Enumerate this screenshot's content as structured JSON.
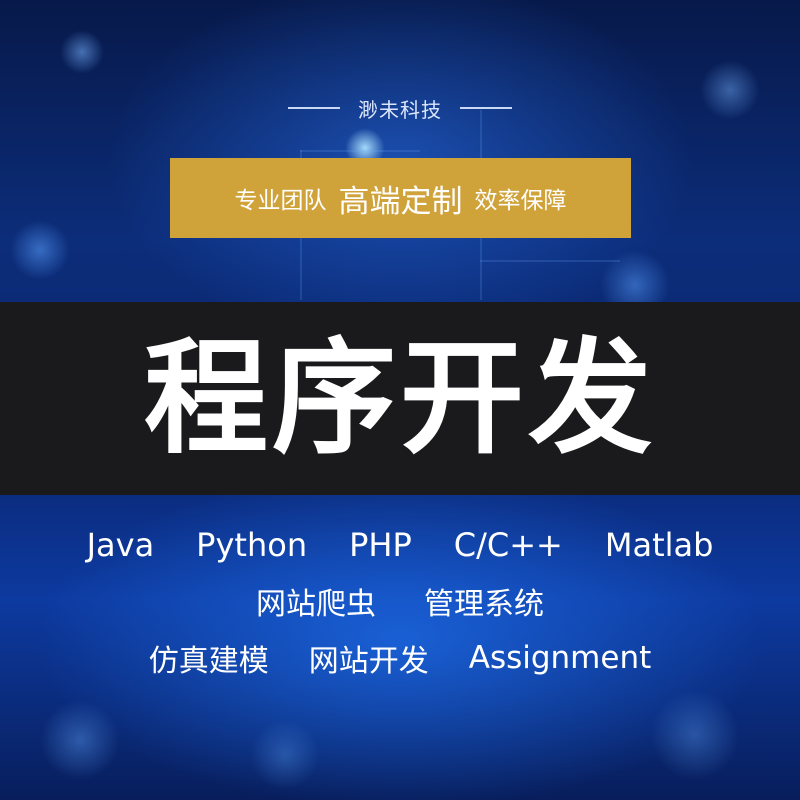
{
  "brand": {
    "name": "渺未科技"
  },
  "slogan": {
    "part1": "专业团队",
    "part2": "高端定制",
    "part3": "效率保障"
  },
  "title": "程序开发",
  "languages": [
    "Java",
    "Python",
    "PHP",
    "C/C++",
    "Matlab"
  ],
  "services_row1": [
    "网站爬虫",
    "管理系统"
  ],
  "services_row2": [
    "仿真建模",
    "网站开发",
    "Assignment"
  ],
  "colors": {
    "slogan_bar": "#d0a23a",
    "title_band": "#1a1a1c",
    "background": "#0c2d7a",
    "text": "#ffffff"
  }
}
